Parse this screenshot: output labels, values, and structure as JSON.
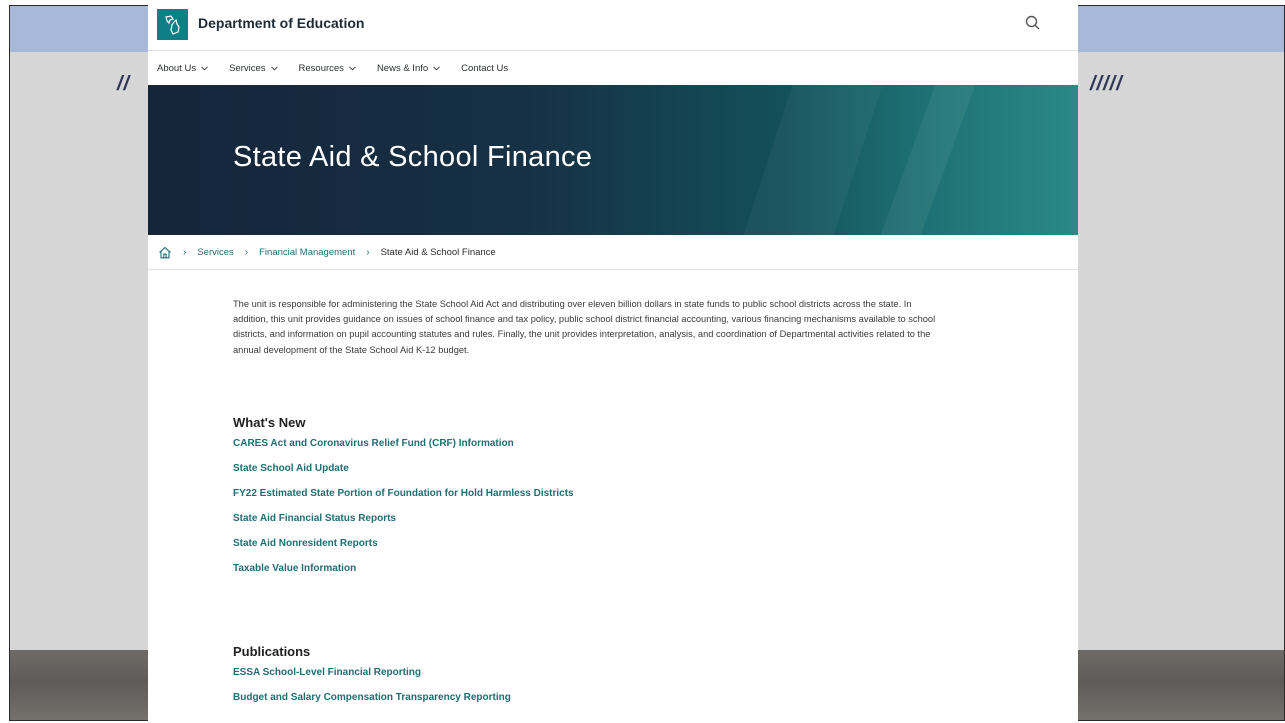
{
  "colors": {
    "accent": "#1f6e73",
    "logo_bg": "#0f7f86",
    "slide_band": "#a7b8d9"
  },
  "slide": {
    "left_mark": "//",
    "right_mark": "/////"
  },
  "header": {
    "site_title": "Department of Education",
    "logo_icon": "michigan-map-icon",
    "search_icon": "search-icon"
  },
  "nav": {
    "items": [
      {
        "label": "About Us",
        "has_dropdown": true
      },
      {
        "label": "Services",
        "has_dropdown": true
      },
      {
        "label": "Resources",
        "has_dropdown": true
      },
      {
        "label": "News & Info",
        "has_dropdown": true
      },
      {
        "label": "Contact Us",
        "has_dropdown": false
      }
    ]
  },
  "hero": {
    "title": "State Aid & School Finance"
  },
  "breadcrumb": {
    "home_icon": "home-icon",
    "items": [
      "Services",
      "Financial Management"
    ],
    "current": "State Aid & School Finance"
  },
  "intro": "The unit is responsible for administering the State School Aid Act and distributing over eleven billion dollars in state funds to public school districts across the state. In addition, this unit provides guidance on issues of school finance and tax policy, public school district financial accounting, various financing mechanisms available to school districts, and information on pupil accounting statutes and rules. Finally, the unit provides interpretation, analysis, and coordination of Departmental activities related to the annual development of the State School Aid K-12 budget.",
  "whats_new": {
    "title": "What's New",
    "links": [
      "CARES Act and Coronavirus Relief Fund (CRF) Information",
      "State School Aid Update",
      "FY22 Estimated State Portion of Foundation for Hold Harmless Districts",
      "State Aid Financial Status Reports",
      "State Aid Nonresident Reports",
      "Taxable Value Information"
    ]
  },
  "publications": {
    "title": "Publications",
    "links": [
      "ESSA School-Level Financial Reporting",
      "Budget and Salary Compensation Transparency Reporting"
    ]
  }
}
